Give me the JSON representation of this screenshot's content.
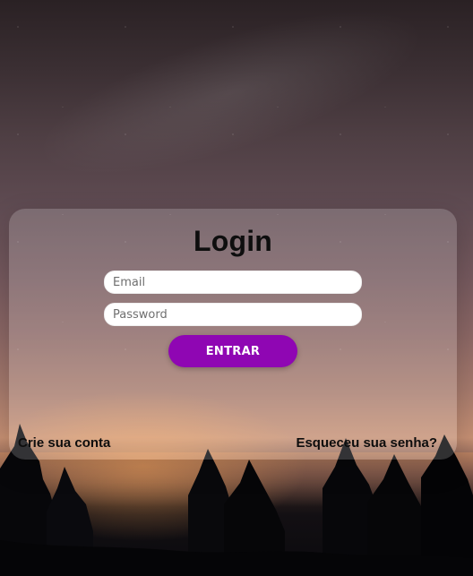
{
  "login": {
    "title": "Login",
    "email_placeholder": "Email",
    "password_placeholder": "Password",
    "submit_label": "ENTRAR",
    "create_account": "Crie sua conta",
    "forgot_password": "Esqueceu sua senha?"
  },
  "colors": {
    "accent": "#8f06b3"
  }
}
